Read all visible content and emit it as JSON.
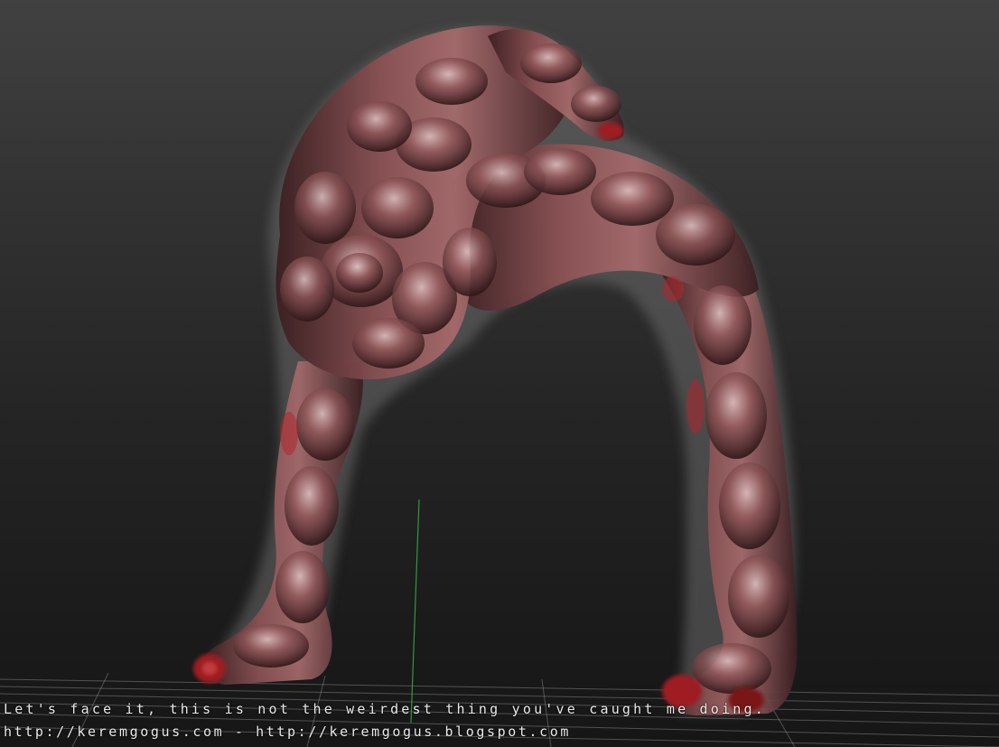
{
  "render": {
    "subject": "sculpted-bulbous-arch-creature",
    "background_top": "#414141",
    "background_bottom": "#161616",
    "skin_color": "#7a4446",
    "skin_highlight": "#d8b6b6",
    "shadow_color": "#2a1416",
    "accent_red": "#9e1f24",
    "ground_grid_color": "#bdbdbd",
    "y_axis_color": "#2f9a3a"
  },
  "caption": {
    "line_1": "Let's face it, this is not the weirdest thing you've caught me doing.",
    "line_2": "http://keremgogus.com - http://keremgogus.blogspot.com"
  }
}
